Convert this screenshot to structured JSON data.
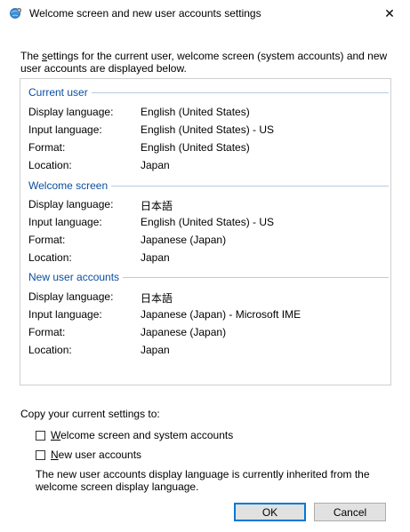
{
  "window": {
    "title": "Welcome screen and new user accounts settings",
    "close_glyph": "✕"
  },
  "description": {
    "prefix": "The ",
    "underlined": "s",
    "rest": "ettings for the current user, welcome screen (system accounts) and new user accounts are displayed below."
  },
  "sections": {
    "current_user": {
      "header": "Current user",
      "rows": [
        {
          "key": "Display language:",
          "value": "English (United States)"
        },
        {
          "key": "Input language:",
          "value": "English (United States) - US"
        },
        {
          "key": "Format:",
          "value": "English (United States)"
        },
        {
          "key": "Location:",
          "value": "Japan"
        }
      ]
    },
    "welcome_screen": {
      "header": "Welcome screen",
      "rows": [
        {
          "key": "Display language:",
          "value": "日本語"
        },
        {
          "key": "Input language:",
          "value": "English (United States) - US"
        },
        {
          "key": "Format:",
          "value": "Japanese (Japan)"
        },
        {
          "key": "Location:",
          "value": "Japan"
        }
      ]
    },
    "new_user_accounts": {
      "header": "New user accounts",
      "rows": [
        {
          "key": "Display language:",
          "value": "日本語"
        },
        {
          "key": "Input language:",
          "value": "Japanese (Japan) - Microsoft IME"
        },
        {
          "key": "Format:",
          "value": "Japanese (Japan)"
        },
        {
          "key": "Location:",
          "value": "Japan"
        }
      ]
    }
  },
  "copy": {
    "label": "Copy your current settings to:",
    "welcome_checkbox": {
      "underlined": "W",
      "rest": "elcome screen and system accounts",
      "checked": false
    },
    "new_user_checkbox": {
      "underlined": "N",
      "rest": "ew user accounts",
      "checked": false
    },
    "note": "The new user accounts display language is currently inherited from the welcome screen display language."
  },
  "buttons": {
    "ok": "OK",
    "cancel": "Cancel"
  },
  "colors": {
    "section_header": "#0a4fa0",
    "section_line": "#b9cbe1",
    "default_button_border": "#0078d7"
  },
  "icons": {
    "title": "globe-settings-icon",
    "close": "close-icon"
  }
}
